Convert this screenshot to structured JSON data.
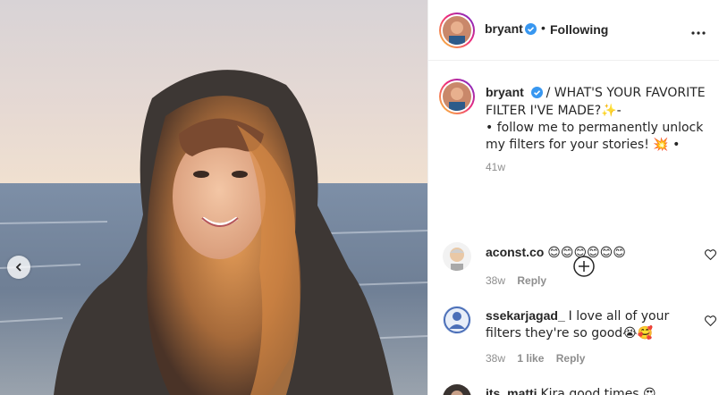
{
  "post": {
    "author": "bryant",
    "follow_status": "Following",
    "dot": "•",
    "caption": "/ WHAT'S YOUR FAVORITE FILTER I'VE MADE?✨-\n• follow me to permanently unlock my filters for your stories! 💥 •",
    "time": "41w"
  },
  "comments": [
    {
      "user": "aconst.co",
      "text": "😊😊😊😊😊😊",
      "time": "38w",
      "likes": "",
      "reply": "Reply"
    },
    {
      "user": "ssekarjagad_",
      "text": "I love all of your filters they're so good😭🥰",
      "time": "38w",
      "likes": "1 like",
      "reply": "Reply"
    },
    {
      "user": "its_matti",
      "text": "Kira good times 😍",
      "time": "",
      "likes": "",
      "reply": ""
    }
  ],
  "icons": {
    "verified": "verified-badge-icon",
    "more": "more-options-icon",
    "load_more": "plus-circle-icon",
    "heart": "heart-outline-icon",
    "prev": "chevron-left-icon"
  },
  "colors": {
    "verified": "#3897f0",
    "muted": "#8e8e8e",
    "text": "#262626"
  }
}
